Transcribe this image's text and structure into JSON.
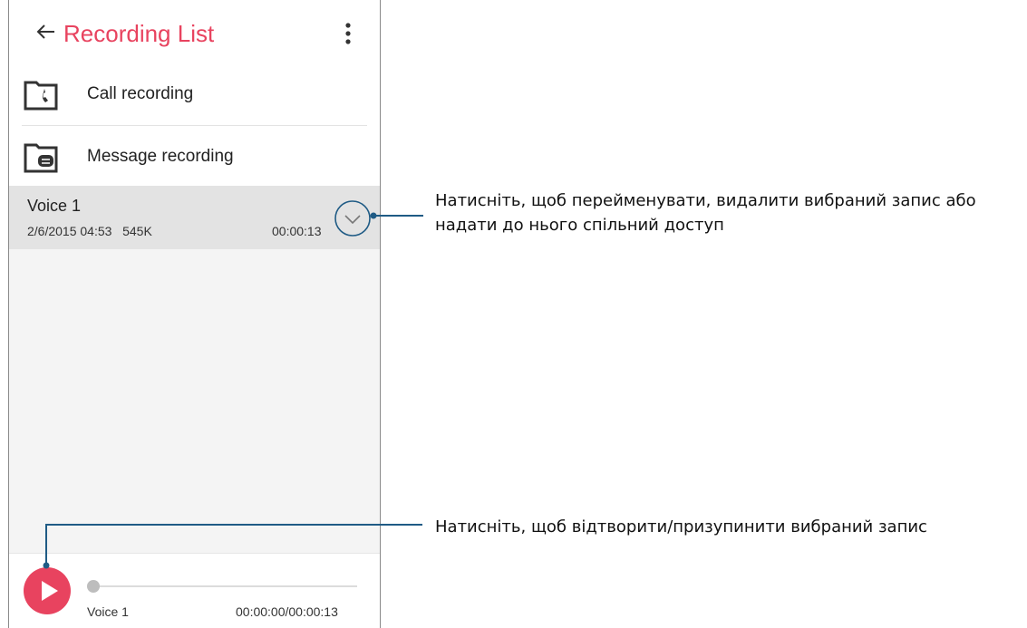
{
  "app": {
    "title": "Recording List"
  },
  "folders": [
    {
      "label": "Call recording",
      "icon": "call-folder-icon"
    },
    {
      "label": "Message recording",
      "icon": "message-folder-icon"
    }
  ],
  "recordings": [
    {
      "name": "Voice 1",
      "date": "2/6/2015 04:53",
      "size": "545K",
      "duration": "00:00:13"
    }
  ],
  "player": {
    "track_name": "Voice 1",
    "time": "00:00:00/00:00:13",
    "progress": 0
  },
  "callouts": {
    "expand": "Натисніть, щоб перейменувати, видалити вибраний запис або надати до нього спільний доступ",
    "play": "Натисніть, щоб відтворити/призупинити вибраний запис"
  },
  "colors": {
    "accent": "#e8435f",
    "callout_line": "#1f5b85",
    "selected_row": "#e3e3e3",
    "list_background": "#f4f4f4"
  }
}
